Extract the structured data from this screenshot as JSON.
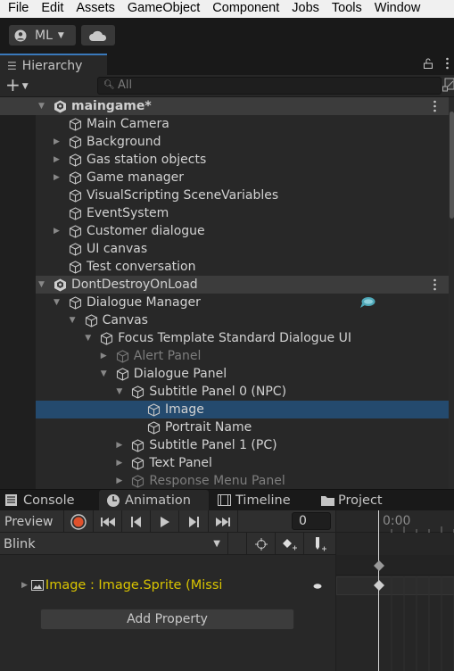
{
  "menu": [
    "File",
    "Edit",
    "Assets",
    "GameObject",
    "Component",
    "Jobs",
    "Tools",
    "Window"
  ],
  "toolbar": {
    "account_label": "ML"
  },
  "hierarchy": {
    "tab_label": "Hierarchy",
    "search_placeholder": "All",
    "rows": [
      {
        "label": "maingame*",
        "level": 0,
        "type": "scene",
        "arrow": "down"
      },
      {
        "label": "Main Camera",
        "level": 1,
        "arrow": "none"
      },
      {
        "label": "Background",
        "level": 1,
        "arrow": "right"
      },
      {
        "label": "Gas station objects",
        "level": 1,
        "arrow": "right"
      },
      {
        "label": "Game manager",
        "level": 1,
        "arrow": "right"
      },
      {
        "label": "VisualScripting SceneVariables",
        "level": 1,
        "arrow": "none"
      },
      {
        "label": "EventSystem",
        "level": 1,
        "arrow": "none"
      },
      {
        "label": "Customer dialogue",
        "level": 1,
        "arrow": "right"
      },
      {
        "label": "UI canvas",
        "level": 1,
        "arrow": "none"
      },
      {
        "label": "Test conversation",
        "level": 1,
        "arrow": "none"
      },
      {
        "label": "DontDestroyOnLoad",
        "level": 0,
        "type": "scene",
        "arrow": "down"
      },
      {
        "label": "Dialogue Manager",
        "level": 1,
        "arrow": "down",
        "badge": "chat-bubble"
      },
      {
        "label": "Canvas",
        "level": 2,
        "arrow": "down"
      },
      {
        "label": "Focus Template Standard Dialogue UI",
        "level": 3,
        "arrow": "down"
      },
      {
        "label": "Alert Panel",
        "level": 4,
        "arrow": "right",
        "inactive": true
      },
      {
        "label": "Dialogue Panel",
        "level": 4,
        "arrow": "down"
      },
      {
        "label": "Subtitle Panel 0 (NPC)",
        "level": 5,
        "arrow": "down"
      },
      {
        "label": "Image",
        "level": 6,
        "arrow": "none",
        "selected": true
      },
      {
        "label": "Portrait Name",
        "level": 6,
        "arrow": "none"
      },
      {
        "label": "Subtitle Panel 1 (PC)",
        "level": 5,
        "arrow": "right"
      },
      {
        "label": "Text Panel",
        "level": 5,
        "arrow": "right"
      },
      {
        "label": "Response Menu Panel",
        "level": 5,
        "arrow": "right",
        "inactive": true
      }
    ]
  },
  "bottom_tabs": [
    {
      "label": "Console",
      "icon": "console-icon"
    },
    {
      "label": "Animation",
      "icon": "clock-icon",
      "active": true
    },
    {
      "label": "Timeline",
      "icon": "film-icon"
    },
    {
      "label": "Project",
      "icon": "folder-icon"
    }
  ],
  "animation": {
    "preview_label": "Preview",
    "frame_value": "0",
    "clip": "Blink",
    "property_label": "Image : Image.Sprite (Missi",
    "add_property_label": "Add Property",
    "timeline_start": "0:00",
    "colors": {
      "record": "#e0512c",
      "property_text": "#d9c400",
      "selection": "#244a6e"
    }
  }
}
